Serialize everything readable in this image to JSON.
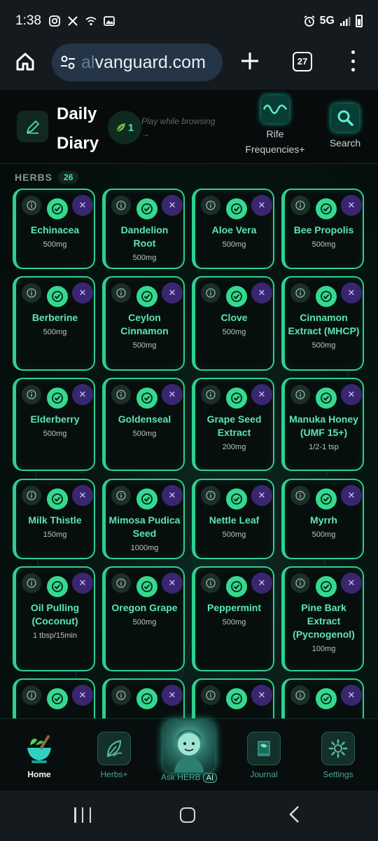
{
  "status_bar": {
    "time": "1:38",
    "network": "5G"
  },
  "browser": {
    "url_faded": "al",
    "url_text": "vanguard.com",
    "tab_count": "27"
  },
  "header": {
    "title_line1": "Daily",
    "title_line2": "Diary",
    "leaf_count": "1",
    "play_hint_line1": "Play while browsing",
    "play_hint_line2": "→",
    "rife_label_line1": "Rife",
    "rife_label_line2": "Frequencies+",
    "search_label": "Search"
  },
  "section": {
    "label": "HERBS",
    "count": "26"
  },
  "herbs": [
    {
      "name": "Echinacea",
      "dose": "500mg"
    },
    {
      "name": "Dandelion Root",
      "dose": "500mg"
    },
    {
      "name": "Aloe Vera",
      "dose": "500mg"
    },
    {
      "name": "Bee Propolis",
      "dose": "500mg"
    },
    {
      "name": "Berberine",
      "dose": "500mg"
    },
    {
      "name": "Ceylon Cinnamon",
      "dose": "500mg"
    },
    {
      "name": "Clove",
      "dose": "500mg"
    },
    {
      "name": "Cinnamon Extract (MHCP)",
      "dose": "500mg"
    },
    {
      "name": "Elderberry",
      "dose": "500mg"
    },
    {
      "name": "Goldenseal",
      "dose": "500mg"
    },
    {
      "name": "Grape Seed Extract",
      "dose": "200mg"
    },
    {
      "name": "Manuka Honey (UMF 15+)",
      "dose": "1/2-1 tsp"
    },
    {
      "name": "Milk Thistle",
      "dose": "150mg"
    },
    {
      "name": "Mimosa Pudica Seed",
      "dose": "1000mg"
    },
    {
      "name": "Nettle Leaf",
      "dose": "500mg"
    },
    {
      "name": "Myrrh",
      "dose": "500mg"
    },
    {
      "name": "Oil Pulling (Coconut)",
      "dose": "1 tbsp/15min"
    },
    {
      "name": "Oregon Grape",
      "dose": "500mg"
    },
    {
      "name": "Peppermint",
      "dose": "500mg"
    },
    {
      "name": "Pine Bark Extract (Pycnogenol)",
      "dose": "100mg"
    },
    {
      "name": "",
      "dose": ""
    },
    {
      "name": "",
      "dose": ""
    },
    {
      "name": "",
      "dose": ""
    },
    {
      "name": "",
      "dose": ""
    }
  ],
  "bottom_nav": {
    "home": "Home",
    "herbs_plus": "Herbs+",
    "ask_herb": "Ask HERB",
    "ai_tag": "AI",
    "journal": "Journal",
    "settings": "Settings"
  },
  "colors": {
    "accent": "#34d98f",
    "card_border": "#2fcf8f",
    "remove_bg": "#3a2670",
    "name_text": "#5de6b0"
  },
  "icons": [
    "home-icon",
    "site-settings-icon",
    "plus-icon",
    "tabs-icon",
    "more-icon",
    "pencil-icon",
    "leaf-icon",
    "waveform-icon",
    "magnifier-icon",
    "info-icon",
    "check-icon",
    "close-icon",
    "mortar-pestle-icon",
    "herb-leaf-icon",
    "journal-book-icon",
    "gear-icon"
  ]
}
